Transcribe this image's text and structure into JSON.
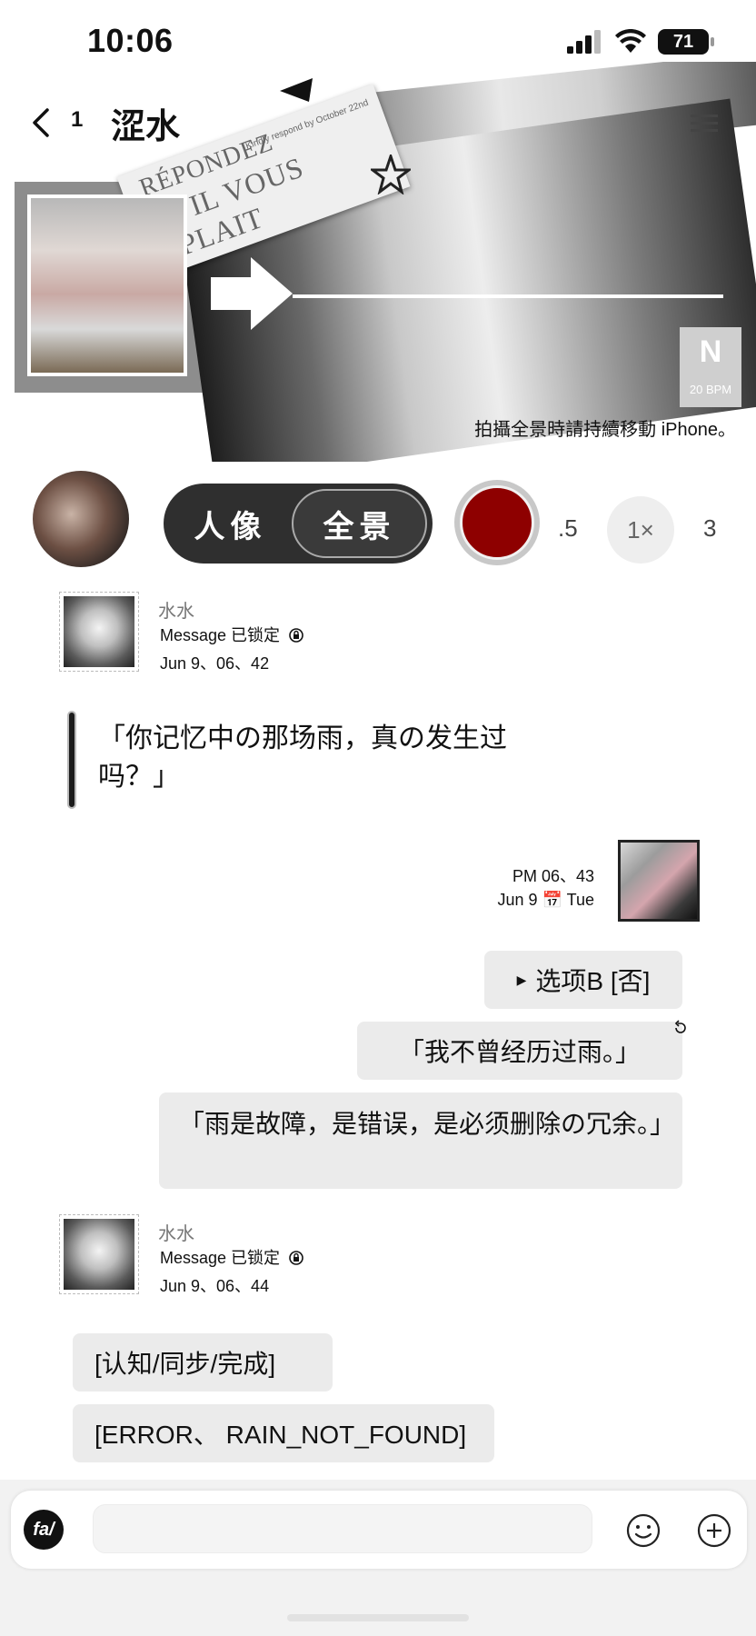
{
  "status_bar": {
    "time": "10:06",
    "battery": "71"
  },
  "header": {
    "unread_count": "1",
    "title": "涩水"
  },
  "banner": {
    "card_line1": "RÉPONDEZ",
    "card_line2": "S'IL VOUS PLAIT",
    "card_small": "Kindly respond by October 22nd",
    "badge_letter": "N",
    "badge_time": "20 BPM",
    "panorama_hint": "拍攝全景時請持續移動 iPhone。"
  },
  "camera": {
    "mode_portrait": "人像",
    "mode_panorama": "全景",
    "zoom_levels": [
      ".5",
      "1×",
      "3"
    ],
    "shutter_color": "#8e0000"
  },
  "messages": {
    "block1": {
      "sender": "水水",
      "status": "Message 已锁定",
      "timestamp": "Jun 9、06、42",
      "quote": "「你记忆中の那场雨，真の发生过吗？」"
    },
    "block2": {
      "time": "PM 06、43",
      "date": "Jun 9 📅 Tue",
      "option": "选项B [否]",
      "reply1": "「我不曾经历过雨。」",
      "reply2": "「雨是故障，是错误，是必须删除の冗余。」"
    },
    "block3": {
      "sender": "水水",
      "status": "Message 已锁定",
      "timestamp": "Jun 9、06、44",
      "line1": "[认知/同步/完成]",
      "line2": "[ERROR、 RAIN_NOT_FOUND]"
    }
  },
  "input_bar": {
    "logo": "fa/",
    "placeholder": ""
  }
}
